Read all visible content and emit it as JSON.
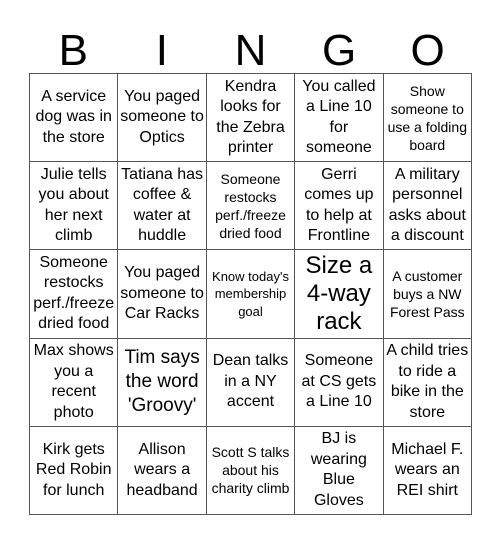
{
  "header": {
    "letters": [
      "B",
      "I",
      "N",
      "G",
      "O"
    ]
  },
  "cells": [
    "A service dog was in the store",
    "You paged someone to Optics",
    "Kendra looks for the Zebra printer",
    "You called a Line 10 for someone",
    "Show someone to use a folding board",
    "Julie tells you about her next climb",
    "Tatiana has coffee & water at huddle",
    "Someone restocks perf./freeze dried food",
    "Gerri comes up to help at Frontline",
    "A military personnel asks about a discount",
    "Someone restocks perf./freeze dried food",
    "You paged someone to Car Racks",
    "Know today's membership goal",
    "Size a 4-way rack",
    "A customer buys a NW Forest Pass",
    "Max shows you a recent photo",
    "Tim says the word 'Groovy'",
    "Dean talks in a NY accent",
    "Someone at CS gets a Line 10",
    "A child tries to ride a bike in the store",
    "Kirk gets Red Robin for lunch",
    "Allison wears a headband",
    "Scott S talks about his charity climb",
    "BJ is wearing Blue Gloves",
    "Michael F. wears an REI shirt"
  ]
}
